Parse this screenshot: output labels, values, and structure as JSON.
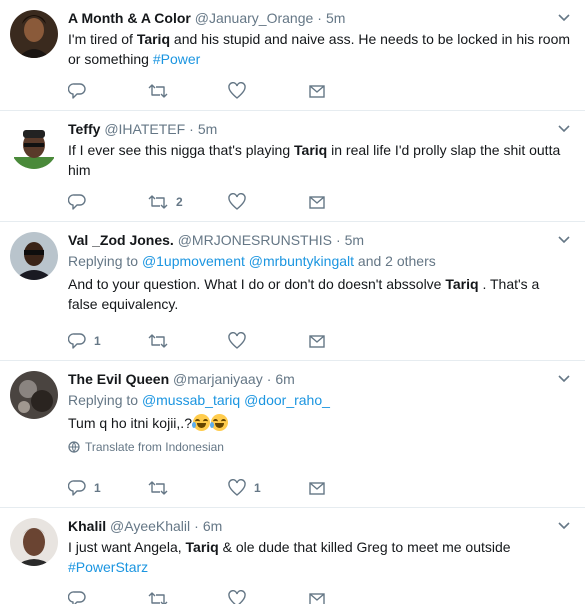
{
  "tweets": [
    {
      "fullname": "A Month & A Color",
      "username": "@January_Orange",
      "dot": "·",
      "time": "5m",
      "text_parts": [
        "I'm tired of ",
        "Tariq",
        " and his stupid and naive ass. He needs to be locked in his room or something ",
        "#Power"
      ],
      "reply_count": "",
      "retweet_count": "",
      "like_count": ""
    },
    {
      "fullname": "Teffy",
      "username": "@IHATETEF",
      "dot": "·",
      "time": "5m",
      "text_parts": [
        "If I ever see this nigga that's playing ",
        "Tariq",
        " in real life I'd prolly slap the shit outta him"
      ],
      "reply_count": "",
      "retweet_count": "2",
      "like_count": ""
    },
    {
      "fullname": "Val _Zod Jones.",
      "username": "@MRJONESRUNSTHIS",
      "dot": "·",
      "time": "5m",
      "replying_prefix": "Replying to ",
      "replying_mentions": [
        "@1upmovement",
        "@mrbuntykingalt"
      ],
      "replying_suffix": " and 2 others",
      "text_parts": [
        "And to your question. What I do or don't do doesn't abssolve ",
        "Tariq",
        " . That's a false equivalency."
      ],
      "reply_count": "1",
      "retweet_count": "",
      "like_count": ""
    },
    {
      "fullname": "The Evil Queen",
      "username": "@marjaniyaay",
      "dot": "·",
      "time": "6m",
      "replying_prefix": "Replying to ",
      "replying_mentions": [
        "@mussab_tariq",
        "@door_raho_"
      ],
      "text": "Tum q ho itni kojii,.?",
      "translate": "Translate from Indonesian",
      "reply_count": "1",
      "retweet_count": "",
      "like_count": "1"
    },
    {
      "fullname": "Khalil",
      "username": "@AyeeKhalil",
      "dot": "·",
      "time": "6m",
      "text_parts": [
        "I just want Angela, ",
        "Tariq",
        " & ole dude that killed Greg to meet me outside ",
        "#PowerStarz"
      ],
      "reply_count": "",
      "retweet_count": "",
      "like_count": ""
    }
  ],
  "colors": {
    "link": "#1b95e0",
    "secondary": "#657786",
    "text": "#14171a",
    "border": "#e6ecf0"
  }
}
